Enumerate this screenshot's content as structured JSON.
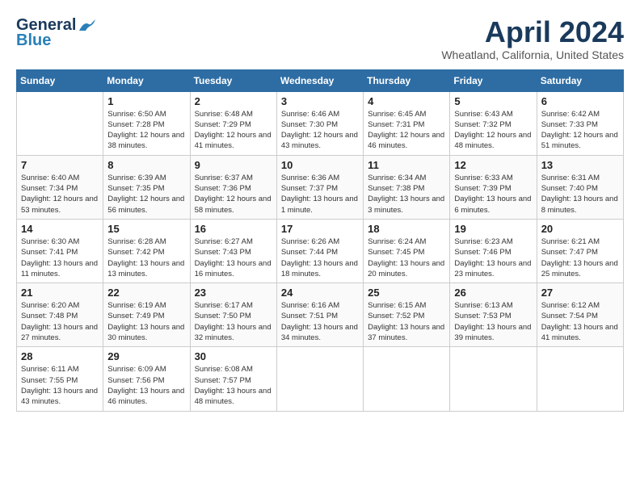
{
  "header": {
    "logo": {
      "line1": "General",
      "line2": "Blue"
    },
    "title": "April 2024",
    "location": "Wheatland, California, United States"
  },
  "weekdays": [
    "Sunday",
    "Monday",
    "Tuesday",
    "Wednesday",
    "Thursday",
    "Friday",
    "Saturday"
  ],
  "weeks": [
    [
      {
        "day": "",
        "sunrise": "",
        "sunset": "",
        "daylight": ""
      },
      {
        "day": "1",
        "sunrise": "Sunrise: 6:50 AM",
        "sunset": "Sunset: 7:28 PM",
        "daylight": "Daylight: 12 hours and 38 minutes."
      },
      {
        "day": "2",
        "sunrise": "Sunrise: 6:48 AM",
        "sunset": "Sunset: 7:29 PM",
        "daylight": "Daylight: 12 hours and 41 minutes."
      },
      {
        "day": "3",
        "sunrise": "Sunrise: 6:46 AM",
        "sunset": "Sunset: 7:30 PM",
        "daylight": "Daylight: 12 hours and 43 minutes."
      },
      {
        "day": "4",
        "sunrise": "Sunrise: 6:45 AM",
        "sunset": "Sunset: 7:31 PM",
        "daylight": "Daylight: 12 hours and 46 minutes."
      },
      {
        "day": "5",
        "sunrise": "Sunrise: 6:43 AM",
        "sunset": "Sunset: 7:32 PM",
        "daylight": "Daylight: 12 hours and 48 minutes."
      },
      {
        "day": "6",
        "sunrise": "Sunrise: 6:42 AM",
        "sunset": "Sunset: 7:33 PM",
        "daylight": "Daylight: 12 hours and 51 minutes."
      }
    ],
    [
      {
        "day": "7",
        "sunrise": "Sunrise: 6:40 AM",
        "sunset": "Sunset: 7:34 PM",
        "daylight": "Daylight: 12 hours and 53 minutes."
      },
      {
        "day": "8",
        "sunrise": "Sunrise: 6:39 AM",
        "sunset": "Sunset: 7:35 PM",
        "daylight": "Daylight: 12 hours and 56 minutes."
      },
      {
        "day": "9",
        "sunrise": "Sunrise: 6:37 AM",
        "sunset": "Sunset: 7:36 PM",
        "daylight": "Daylight: 12 hours and 58 minutes."
      },
      {
        "day": "10",
        "sunrise": "Sunrise: 6:36 AM",
        "sunset": "Sunset: 7:37 PM",
        "daylight": "Daylight: 13 hours and 1 minute."
      },
      {
        "day": "11",
        "sunrise": "Sunrise: 6:34 AM",
        "sunset": "Sunset: 7:38 PM",
        "daylight": "Daylight: 13 hours and 3 minutes."
      },
      {
        "day": "12",
        "sunrise": "Sunrise: 6:33 AM",
        "sunset": "Sunset: 7:39 PM",
        "daylight": "Daylight: 13 hours and 6 minutes."
      },
      {
        "day": "13",
        "sunrise": "Sunrise: 6:31 AM",
        "sunset": "Sunset: 7:40 PM",
        "daylight": "Daylight: 13 hours and 8 minutes."
      }
    ],
    [
      {
        "day": "14",
        "sunrise": "Sunrise: 6:30 AM",
        "sunset": "Sunset: 7:41 PM",
        "daylight": "Daylight: 13 hours and 11 minutes."
      },
      {
        "day": "15",
        "sunrise": "Sunrise: 6:28 AM",
        "sunset": "Sunset: 7:42 PM",
        "daylight": "Daylight: 13 hours and 13 minutes."
      },
      {
        "day": "16",
        "sunrise": "Sunrise: 6:27 AM",
        "sunset": "Sunset: 7:43 PM",
        "daylight": "Daylight: 13 hours and 16 minutes."
      },
      {
        "day": "17",
        "sunrise": "Sunrise: 6:26 AM",
        "sunset": "Sunset: 7:44 PM",
        "daylight": "Daylight: 13 hours and 18 minutes."
      },
      {
        "day": "18",
        "sunrise": "Sunrise: 6:24 AM",
        "sunset": "Sunset: 7:45 PM",
        "daylight": "Daylight: 13 hours and 20 minutes."
      },
      {
        "day": "19",
        "sunrise": "Sunrise: 6:23 AM",
        "sunset": "Sunset: 7:46 PM",
        "daylight": "Daylight: 13 hours and 23 minutes."
      },
      {
        "day": "20",
        "sunrise": "Sunrise: 6:21 AM",
        "sunset": "Sunset: 7:47 PM",
        "daylight": "Daylight: 13 hours and 25 minutes."
      }
    ],
    [
      {
        "day": "21",
        "sunrise": "Sunrise: 6:20 AM",
        "sunset": "Sunset: 7:48 PM",
        "daylight": "Daylight: 13 hours and 27 minutes."
      },
      {
        "day": "22",
        "sunrise": "Sunrise: 6:19 AM",
        "sunset": "Sunset: 7:49 PM",
        "daylight": "Daylight: 13 hours and 30 minutes."
      },
      {
        "day": "23",
        "sunrise": "Sunrise: 6:17 AM",
        "sunset": "Sunset: 7:50 PM",
        "daylight": "Daylight: 13 hours and 32 minutes."
      },
      {
        "day": "24",
        "sunrise": "Sunrise: 6:16 AM",
        "sunset": "Sunset: 7:51 PM",
        "daylight": "Daylight: 13 hours and 34 minutes."
      },
      {
        "day": "25",
        "sunrise": "Sunrise: 6:15 AM",
        "sunset": "Sunset: 7:52 PM",
        "daylight": "Daylight: 13 hours and 37 minutes."
      },
      {
        "day": "26",
        "sunrise": "Sunrise: 6:13 AM",
        "sunset": "Sunset: 7:53 PM",
        "daylight": "Daylight: 13 hours and 39 minutes."
      },
      {
        "day": "27",
        "sunrise": "Sunrise: 6:12 AM",
        "sunset": "Sunset: 7:54 PM",
        "daylight": "Daylight: 13 hours and 41 minutes."
      }
    ],
    [
      {
        "day": "28",
        "sunrise": "Sunrise: 6:11 AM",
        "sunset": "Sunset: 7:55 PM",
        "daylight": "Daylight: 13 hours and 43 minutes."
      },
      {
        "day": "29",
        "sunrise": "Sunrise: 6:09 AM",
        "sunset": "Sunset: 7:56 PM",
        "daylight": "Daylight: 13 hours and 46 minutes."
      },
      {
        "day": "30",
        "sunrise": "Sunrise: 6:08 AM",
        "sunset": "Sunset: 7:57 PM",
        "daylight": "Daylight: 13 hours and 48 minutes."
      },
      {
        "day": "",
        "sunrise": "",
        "sunset": "",
        "daylight": ""
      },
      {
        "day": "",
        "sunrise": "",
        "sunset": "",
        "daylight": ""
      },
      {
        "day": "",
        "sunrise": "",
        "sunset": "",
        "daylight": ""
      },
      {
        "day": "",
        "sunrise": "",
        "sunset": "",
        "daylight": ""
      }
    ]
  ]
}
